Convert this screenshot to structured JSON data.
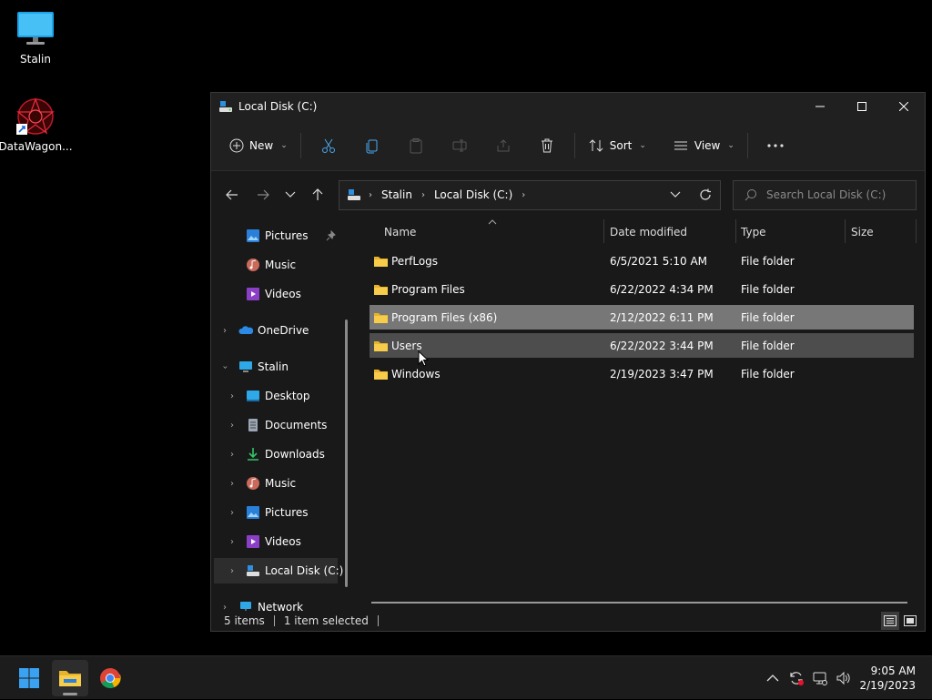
{
  "desktop": {
    "icons": [
      {
        "label": "Stalin"
      },
      {
        "label": "DataWagon..."
      }
    ]
  },
  "window": {
    "title": "Local Disk (C:)",
    "toolbar": {
      "new_label": "New",
      "sort_label": "Sort",
      "view_label": "View"
    },
    "address": {
      "crumbs": [
        "Stalin",
        "Local Disk (C:)"
      ]
    },
    "search": {
      "placeholder": "Search Local Disk (C:)"
    },
    "nav": [
      {
        "label": "Pictures"
      },
      {
        "label": "Music"
      },
      {
        "label": "Videos"
      },
      {
        "label": "OneDrive"
      },
      {
        "label": "Stalin"
      },
      {
        "label": "Desktop"
      },
      {
        "label": "Documents"
      },
      {
        "label": "Downloads"
      },
      {
        "label": "Music"
      },
      {
        "label": "Pictures"
      },
      {
        "label": "Videos"
      },
      {
        "label": "Local Disk (C:)"
      },
      {
        "label": "Network"
      }
    ],
    "columns": {
      "name": "Name",
      "date": "Date modified",
      "type": "Type",
      "size": "Size"
    },
    "files": [
      {
        "name": "PerfLogs",
        "date": "6/5/2021 5:10 AM",
        "type": "File folder"
      },
      {
        "name": "Program Files",
        "date": "6/22/2022 4:34 PM",
        "type": "File folder"
      },
      {
        "name": "Program Files (x86)",
        "date": "2/12/2022 6:11 PM",
        "type": "File folder"
      },
      {
        "name": "Users",
        "date": "6/22/2022 3:44 PM",
        "type": "File folder"
      },
      {
        "name": "Windows",
        "date": "2/19/2023 3:47 PM",
        "type": "File folder"
      }
    ],
    "status": {
      "count": "5 items",
      "selected": "1 item selected"
    }
  },
  "taskbar": {
    "time": "9:05 AM",
    "date": "2/19/2023"
  }
}
